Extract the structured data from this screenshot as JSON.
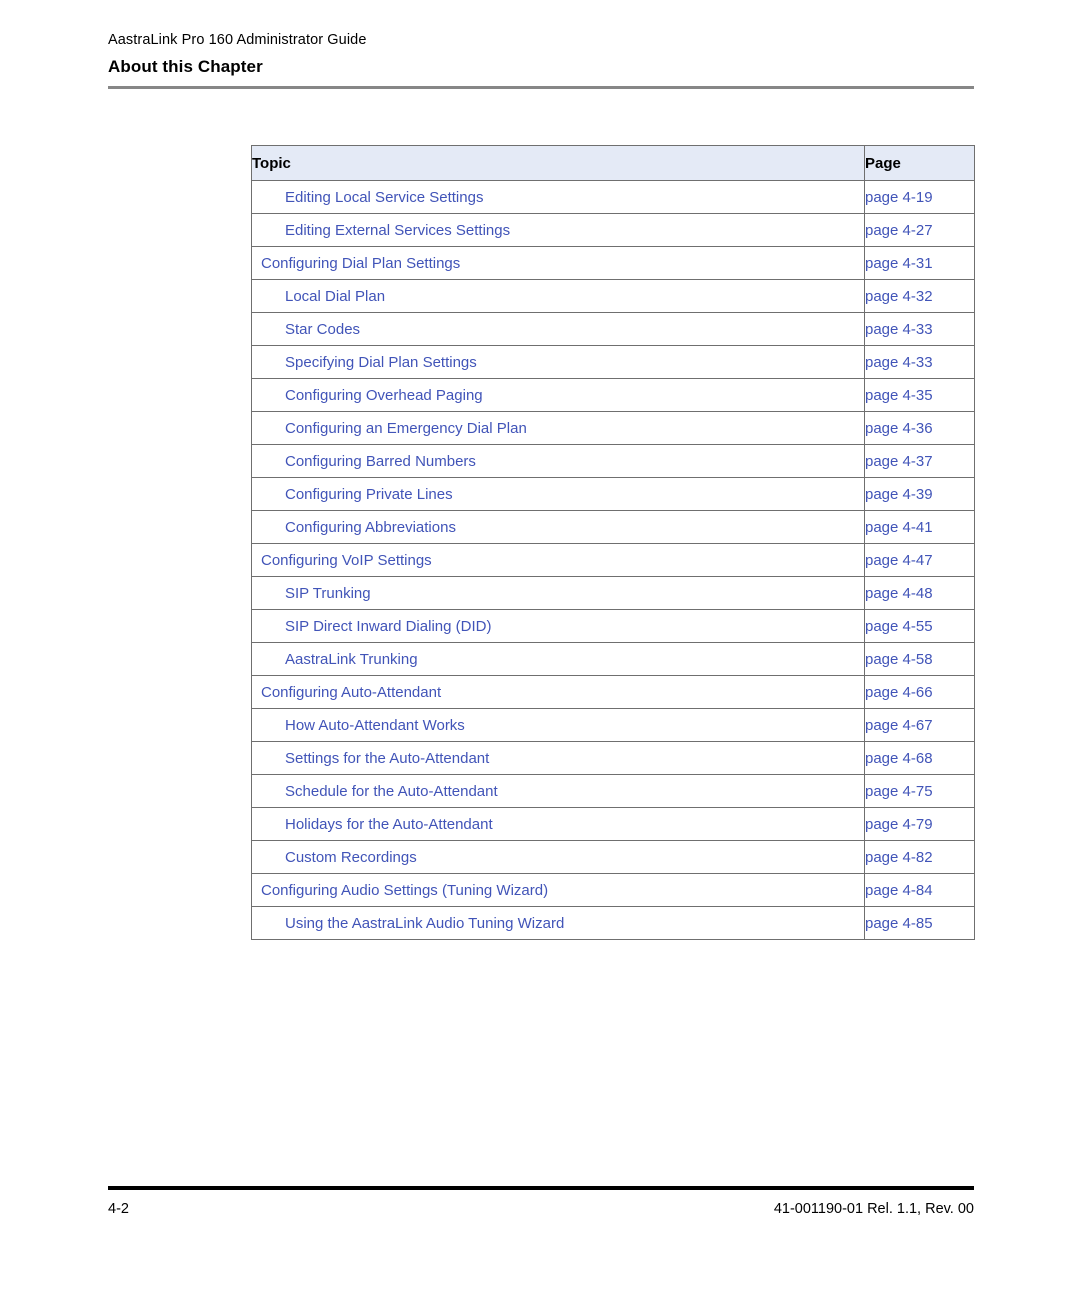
{
  "header": {
    "running_title": "AastraLink Pro 160 Administrator Guide",
    "chapter_title": "About this Chapter"
  },
  "toc": {
    "columns": {
      "topic": "Topic",
      "page": "Page"
    },
    "rows": [
      {
        "level": 2,
        "topic": "Editing Local Service Settings",
        "page": "page 4-19"
      },
      {
        "level": 2,
        "topic": "Editing External Services Settings",
        "page": "page 4-27"
      },
      {
        "level": 1,
        "topic": "Configuring Dial Plan Settings",
        "page": "page 4-31"
      },
      {
        "level": 2,
        "topic": "Local Dial Plan",
        "page": "page 4-32"
      },
      {
        "level": 2,
        "topic": "Star Codes",
        "page": "page 4-33"
      },
      {
        "level": 2,
        "topic": "Specifying Dial Plan Settings",
        "page": "page 4-33"
      },
      {
        "level": 2,
        "topic": "Configuring Overhead Paging",
        "page": "page 4-35"
      },
      {
        "level": 2,
        "topic": "Configuring an Emergency Dial Plan",
        "page": "page 4-36"
      },
      {
        "level": 2,
        "topic": "Configuring Barred Numbers",
        "page": "page 4-37"
      },
      {
        "level": 2,
        "topic": "Configuring Private Lines",
        "page": "page 4-39"
      },
      {
        "level": 2,
        "topic": "Configuring Abbreviations",
        "page": "page 4-41"
      },
      {
        "level": 1,
        "topic": "Configuring VoIP Settings",
        "page": "page 4-47"
      },
      {
        "level": 2,
        "topic": "SIP Trunking",
        "page": "page 4-48"
      },
      {
        "level": 2,
        "topic": "SIP Direct Inward Dialing (DID)",
        "page": "page 4-55"
      },
      {
        "level": 2,
        "topic": "AastraLink Trunking",
        "page": "page 4-58"
      },
      {
        "level": 1,
        "topic": "Configuring Auto-Attendant",
        "page": "page 4-66"
      },
      {
        "level": 2,
        "topic": "How Auto-Attendant Works",
        "page": "page 4-67"
      },
      {
        "level": 2,
        "topic": "Settings for the Auto-Attendant",
        "page": "page 4-68"
      },
      {
        "level": 2,
        "topic": "Schedule for the Auto-Attendant",
        "page": "page 4-75"
      },
      {
        "level": 2,
        "topic": "Holidays for the Auto-Attendant",
        "page": "page 4-79"
      },
      {
        "level": 2,
        "topic": "Custom Recordings",
        "page": "page 4-82"
      },
      {
        "level": 1,
        "topic": "Configuring Audio Settings (Tuning Wizard)",
        "page": "page 4-84"
      },
      {
        "level": 2,
        "topic": "Using the AastraLink Audio Tuning Wizard",
        "page": "page 4-85"
      }
    ]
  },
  "footer": {
    "page_number": "4-2",
    "document_id": "41-001190-01 Rel. 1.1, Rev. 00"
  },
  "colors": {
    "link": "#4154b8",
    "table_header_bg": "#e4eaf6",
    "table_border": "#6f6f6f",
    "header_rule": "#878787",
    "footer_rule": "#000000"
  }
}
